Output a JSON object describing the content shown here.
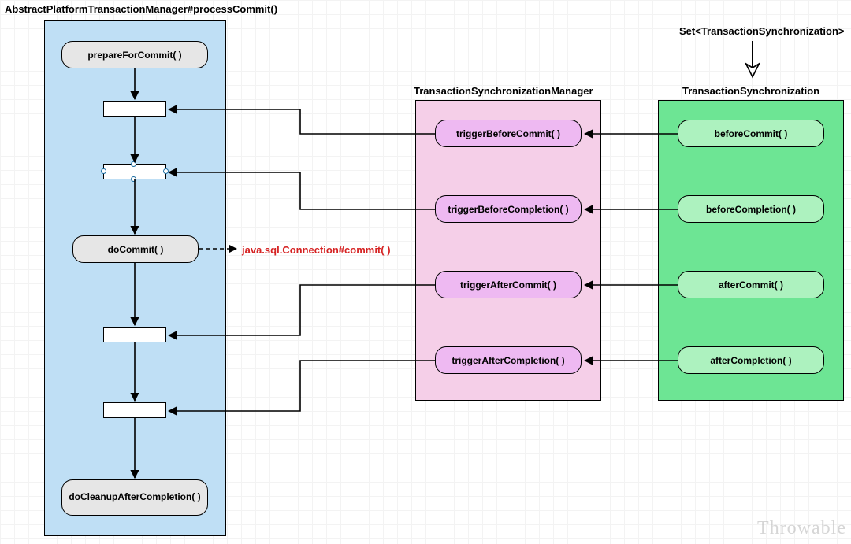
{
  "title": "AbstractPlatformTransactionManager#processCommit()",
  "setLabel": "Set<TransactionSynchronization>",
  "columns": {
    "manager": "TransactionSynchronizationManager",
    "sync": "TransactionSynchronization"
  },
  "left": {
    "prepare": "prepareForCommit( )",
    "doCommit": "doCommit( )",
    "cleanup": "doCleanupAfterCompletion( )"
  },
  "manager": {
    "tBeforeCommit": "triggerBeforeCommit( )",
    "tBeforeCompletion": "triggerBeforeCompletion( )",
    "tAfterCommit": "triggerAfterCommit( )",
    "tAfterCompletion": "triggerAfterCompletion( )"
  },
  "sync": {
    "beforeCommit": "beforeCommit( )",
    "beforeCompletion": "beforeCompletion( )",
    "afterCommit": "afterCommit( )",
    "afterCompletion": "afterCompletion( )"
  },
  "annotation": "java.sql.Connection#commit( )",
  "watermark": "Throwable"
}
